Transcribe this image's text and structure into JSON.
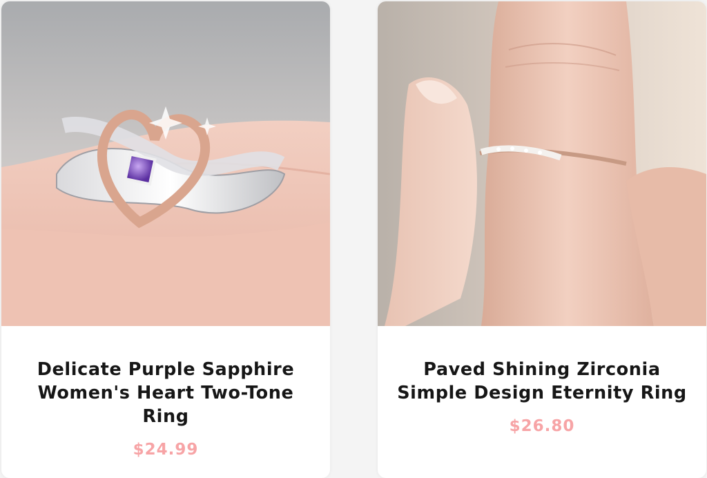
{
  "products": [
    {
      "title": "Delicate Purple Sapphire Women's Heart Two-Tone Ring",
      "price": "$24.99",
      "image_subject": "rose-gold heart ring with purple sapphire held between fingers"
    },
    {
      "title": "Paved Shining Zirconia Simple Design Eternity Ring",
      "price": "$26.80",
      "image_subject": "thin rose-gold paved eternity ring worn on a finger"
    }
  ],
  "colors": {
    "price": "#f7a4a6",
    "title": "#161616",
    "card_background": "#ffffff",
    "page_background": "#f4f4f4"
  }
}
